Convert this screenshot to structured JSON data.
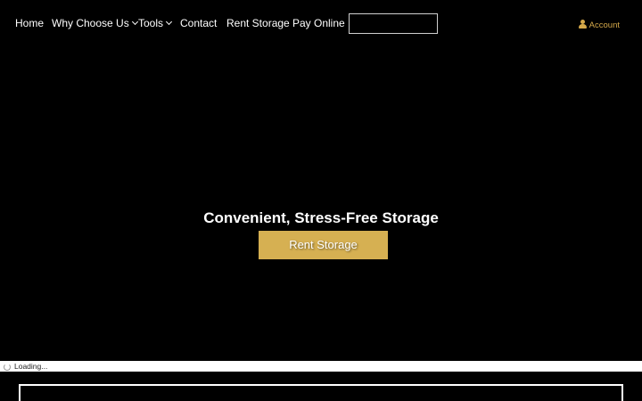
{
  "nav": {
    "items": [
      {
        "label": "Home",
        "has_dropdown": false
      },
      {
        "label": "Why Choose Us",
        "has_dropdown": true
      },
      {
        "label": "Tools",
        "has_dropdown": true
      },
      {
        "label": "Contact",
        "has_dropdown": false
      },
      {
        "label": "Rent Storage",
        "has_dropdown": false
      },
      {
        "label": "Pay Online",
        "has_dropdown": false
      }
    ],
    "search": {
      "value": "",
      "placeholder": ""
    },
    "account": {
      "label": "Account",
      "icon": "user-icon"
    }
  },
  "hero": {
    "title": "Convenient, Stress-Free Storage",
    "button_label": "Rent Storage"
  },
  "status": {
    "text": "Loading...",
    "icon": "spinner-icon"
  },
  "colors": {
    "background": "#000000",
    "accent": "#d6b052",
    "account_text": "#d4a84a",
    "text": "#ffffff"
  }
}
